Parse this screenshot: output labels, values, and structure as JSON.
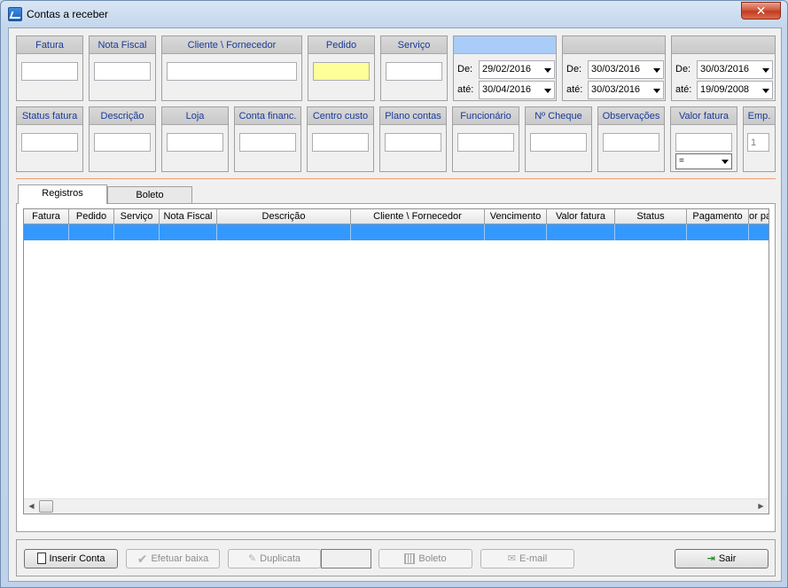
{
  "window": {
    "title": "Contas a receber",
    "close_label": "✕"
  },
  "filters_row1": [
    {
      "key": "fatura",
      "label": "Fatura",
      "value": ""
    },
    {
      "key": "nota_fiscal",
      "label": "Nota Fiscal",
      "value": ""
    },
    {
      "key": "cliente",
      "label": "Cliente \\ Fornecedor",
      "value": ""
    },
    {
      "key": "pedido",
      "label": "Pedido",
      "value": ""
    },
    {
      "key": "servico",
      "label": "Serviço",
      "value": ""
    }
  ],
  "date_filters": [
    {
      "label": "",
      "from_label": "De:",
      "from": "29/02/2016",
      "to_label": "até:",
      "to": "30/04/2016",
      "header_color": "#a9cdf8"
    },
    {
      "label": "",
      "from_label": "De:",
      "from": "30/03/2016",
      "to_label": "até:",
      "to": "30/03/2016",
      "header_color": "#c9c9c9"
    },
    {
      "label": "",
      "from_label": "De:",
      "from": "30/03/2016",
      "to_label": "até:",
      "to": "19/09/2008",
      "header_color": "#c9c9c9"
    }
  ],
  "filters_row2": [
    {
      "key": "status_fatura",
      "label": "Status fatura",
      "value": ""
    },
    {
      "key": "descricao",
      "label": "Descrição",
      "value": ""
    },
    {
      "key": "loja",
      "label": "Loja",
      "value": ""
    },
    {
      "key": "conta_financ",
      "label": "Conta financ.",
      "value": ""
    },
    {
      "key": "centro_custo",
      "label": "Centro custo",
      "value": ""
    },
    {
      "key": "plano_contas",
      "label": "Plano contas",
      "value": ""
    },
    {
      "key": "funcionario",
      "label": "Funcionário",
      "value": ""
    },
    {
      "key": "n_cheque",
      "label": "Nº Cheque",
      "value": ""
    },
    {
      "key": "observacoes",
      "label": "Observações",
      "value": ""
    },
    {
      "key": "valor_fatura",
      "label": "Valor fatura",
      "value": "",
      "operator": "="
    },
    {
      "key": "emp",
      "label": "Emp.",
      "value": "1"
    }
  ],
  "tabs": [
    {
      "label": "Registros",
      "active": true
    },
    {
      "label": "Boleto",
      "active": false
    }
  ],
  "grid": {
    "columns": [
      "Fatura",
      "Pedido",
      "Serviço",
      "Nota Fiscal",
      "Descrição",
      "Cliente \\ Fornecedor",
      "Vencimento",
      "Valor fatura",
      "Status",
      "Pagamento",
      "or pa"
    ]
  },
  "buttons": {
    "inserir_conta": "Inserir Conta",
    "efetuar_baixa": "Efetuar baixa",
    "duplicata": "Duplicata",
    "boleto": "Boleto",
    "email": "E-mail",
    "sair": "Sair"
  },
  "colors": {
    "selected_row": "#3399ff",
    "pedido_highlight": "#ffff99",
    "label_text": "#1a3a9a"
  }
}
